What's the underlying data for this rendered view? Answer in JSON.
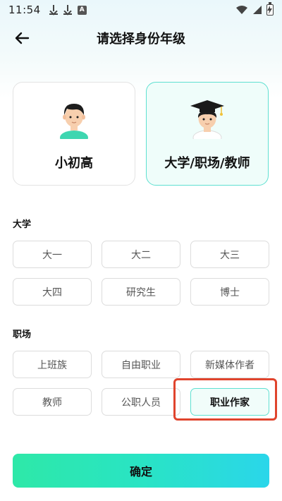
{
  "status_bar": {
    "time": "11:54",
    "icons": [
      "download-icon",
      "download-icon",
      "a-badge-icon",
      "wifi-icon",
      "signal-icon",
      "battery-charging-icon"
    ],
    "a_badge": "A"
  },
  "header": {
    "title": "请选择身份年级",
    "back_icon": "arrow-left-icon"
  },
  "identity_cards": [
    {
      "label": "小初高",
      "icon": "boy-avatar-icon",
      "selected": false
    },
    {
      "label": "大学/职场/教师",
      "icon": "graduate-avatar-icon",
      "selected": true
    }
  ],
  "sections": [
    {
      "title": "大学",
      "options": [
        {
          "label": "大一",
          "selected": false
        },
        {
          "label": "大二",
          "selected": false
        },
        {
          "label": "大三",
          "selected": false
        },
        {
          "label": "大四",
          "selected": false
        },
        {
          "label": "研究生",
          "selected": false
        },
        {
          "label": "博士",
          "selected": false
        }
      ]
    },
    {
      "title": "职场",
      "options": [
        {
          "label": "上班族",
          "selected": false
        },
        {
          "label": "自由职业",
          "selected": false
        },
        {
          "label": "新媒体作者",
          "selected": false
        },
        {
          "label": "教师",
          "selected": false
        },
        {
          "label": "公职人员",
          "selected": false
        },
        {
          "label": "职业作家",
          "selected": true
        }
      ]
    }
  ],
  "confirm_button": {
    "label": "确定"
  },
  "colors": {
    "accent_border": "#5fe0d1",
    "selected_bg": "#effdfa",
    "highlight_red": "#e0442d",
    "button_gradient_start": "#2ee8a8",
    "button_gradient_end": "#2ad6ea"
  }
}
